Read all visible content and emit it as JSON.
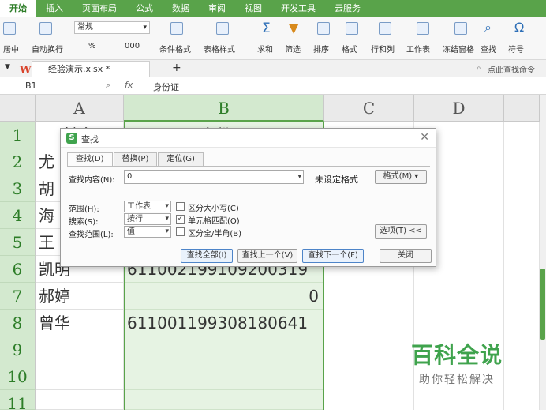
{
  "menu": {
    "tabs": [
      "开始",
      "插入",
      "页面布局",
      "公式",
      "数据",
      "审阅",
      "视图",
      "开发工具",
      "云服务"
    ]
  },
  "ribbon": {
    "number_format": "常规",
    "merge_center": "居中",
    "wrap_text": "自动换行",
    "percent": "%",
    "comma": "000",
    "conditional_format": "条件格式",
    "table_style": "表格样式",
    "sum": "求和",
    "filter": "筛选",
    "sort": "排序",
    "format": "格式",
    "rows_cols": "行和列",
    "worksheet": "工作表",
    "freeze": "冻结窗格",
    "find": "查找",
    "symbol": "符号"
  },
  "tabbar": {
    "doc_name": "经验演示.xlsx *",
    "add": "+",
    "search_placeholder": "点此查找命令"
  },
  "formulabar": {
    "cell_ref": "B1",
    "fx": "fx",
    "content": "身份证"
  },
  "sheet": {
    "columns": [
      "A",
      "B",
      "C",
      "D"
    ],
    "rows": [
      "1",
      "2",
      "3",
      "4",
      "5",
      "6",
      "7",
      "8",
      "9",
      "10",
      "11"
    ],
    "row1": {
      "a": "姓名",
      "b": "身份证"
    },
    "col_a": [
      "尤",
      "胡",
      "海",
      "王",
      "凯明",
      "郝婷",
      "曾华"
    ],
    "col_b_visible": {
      "row6": "611002199109200319",
      "row7": "0",
      "row8": "611001199308180641"
    }
  },
  "dialog": {
    "title": "查找",
    "tabs": [
      "查找(D)",
      "替换(P)",
      "定位(G)"
    ],
    "find_label": "查找内容(N):",
    "find_value": "0",
    "no_format": "未设定格式",
    "format_button": "格式(M)",
    "scope_label": "范围(H):",
    "scope_value": "工作表",
    "search_label": "搜索(S):",
    "search_value": "按行",
    "lookin_label": "查找范围(L):",
    "lookin_value": "值",
    "match_case": "区分大小写(C)",
    "match_cell": "单元格匹配(O)",
    "match_width": "区分全/半角(B)",
    "options_button": "选项(T) <<",
    "find_all": "查找全部(I)",
    "find_prev": "查找上一个(V)",
    "find_next": "查找下一个(F)",
    "close": "关闭"
  },
  "watermark": {
    "title": "百科全说",
    "subtitle": "助你轻松解决"
  },
  "colors": {
    "accent": "#59a34a",
    "selection": "#e6f3e3"
  }
}
